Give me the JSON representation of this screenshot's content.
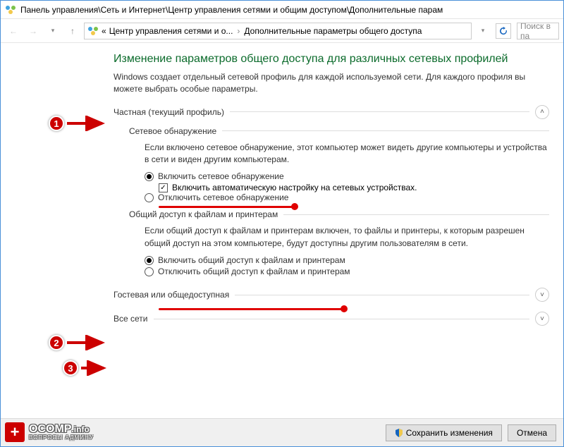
{
  "titlebar": {
    "path": "Панель управления\\Сеть и Интернет\\Центр управления сетями и общим доступом\\Дополнительные парам"
  },
  "nav": {
    "crumb_prefix": "«",
    "crumb1": "Центр управления сетями и о...",
    "crumb2": "Дополнительные параметры общего доступа",
    "search_placeholder": "Поиск в па"
  },
  "main": {
    "heading": "Изменение параметров общего доступа для различных сетевых профилей",
    "description": "Windows создает отдельный сетевой профиль для каждой используемой сети. Для каждого профиля вы можете выбрать особые параметры.",
    "profile_private": "Частная (текущий профиль)",
    "profile_guest": "Гостевая или общедоступная",
    "profile_all": "Все сети",
    "section_discovery": {
      "title": "Сетевое обнаружение",
      "desc": "Если включено сетевое обнаружение, этот компьютер может видеть другие компьютеры и устройства в сети и виден другим компьютерам.",
      "opt_on": "Включить сетевое обнаружение",
      "opt_on_sub": "Включить автоматическую настройку на сетевых устройствах.",
      "opt_off": "Отключить сетевое обнаружение"
    },
    "section_sharing": {
      "title": "Общий доступ к файлам и принтерам",
      "desc": "Если общий доступ к файлам и принтерам включен, то файлы и принтеры, к которым разрешен общий доступ на этом компьютере, будут доступны другим пользователям в сети.",
      "opt_on": "Включить общий доступ к файлам и принтерам",
      "opt_off": "Отключить общий доступ к файлам и принтерам"
    }
  },
  "footer": {
    "save": "Сохранить изменения",
    "cancel": "Отмена"
  },
  "annotations": {
    "b1": "1",
    "b2": "2",
    "b3": "3"
  },
  "watermark": {
    "brand": "OCOMP",
    "suffix": ".info",
    "tagline": "ВОПРОСЫ АДМИНУ"
  }
}
